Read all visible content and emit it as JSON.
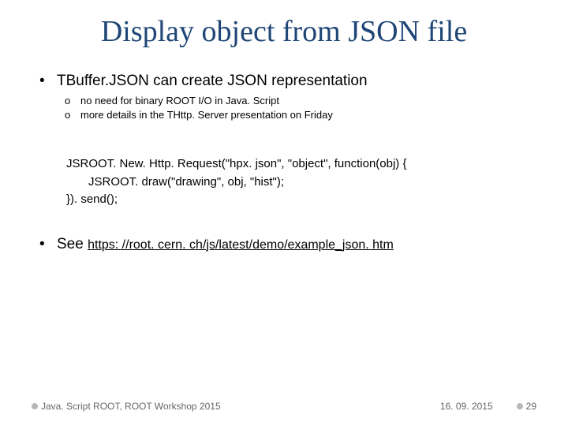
{
  "title": "Display object from JSON file",
  "bullets": {
    "b1": "TBuffer.JSON can create JSON representation",
    "b1_sub1": "no need for binary ROOT I/O in Java. Script",
    "b1_sub2": "more details in the THttp. Server presentation on Friday",
    "b2_prefix": "See ",
    "b2_link": "https: //root. cern. ch/js/latest/demo/example_json. htm"
  },
  "code": {
    "l1": "JSROOT. New. Http. Request(\"hpx. json\", \"object\", function(obj) {",
    "l2": "JSROOT. draw(\"drawing\", obj, \"hist\");",
    "l3": "}). send();"
  },
  "footer": {
    "left": "Java. Script ROOT, ROOT Workshop 2015",
    "date": "16. 09. 2015",
    "page": "29"
  }
}
